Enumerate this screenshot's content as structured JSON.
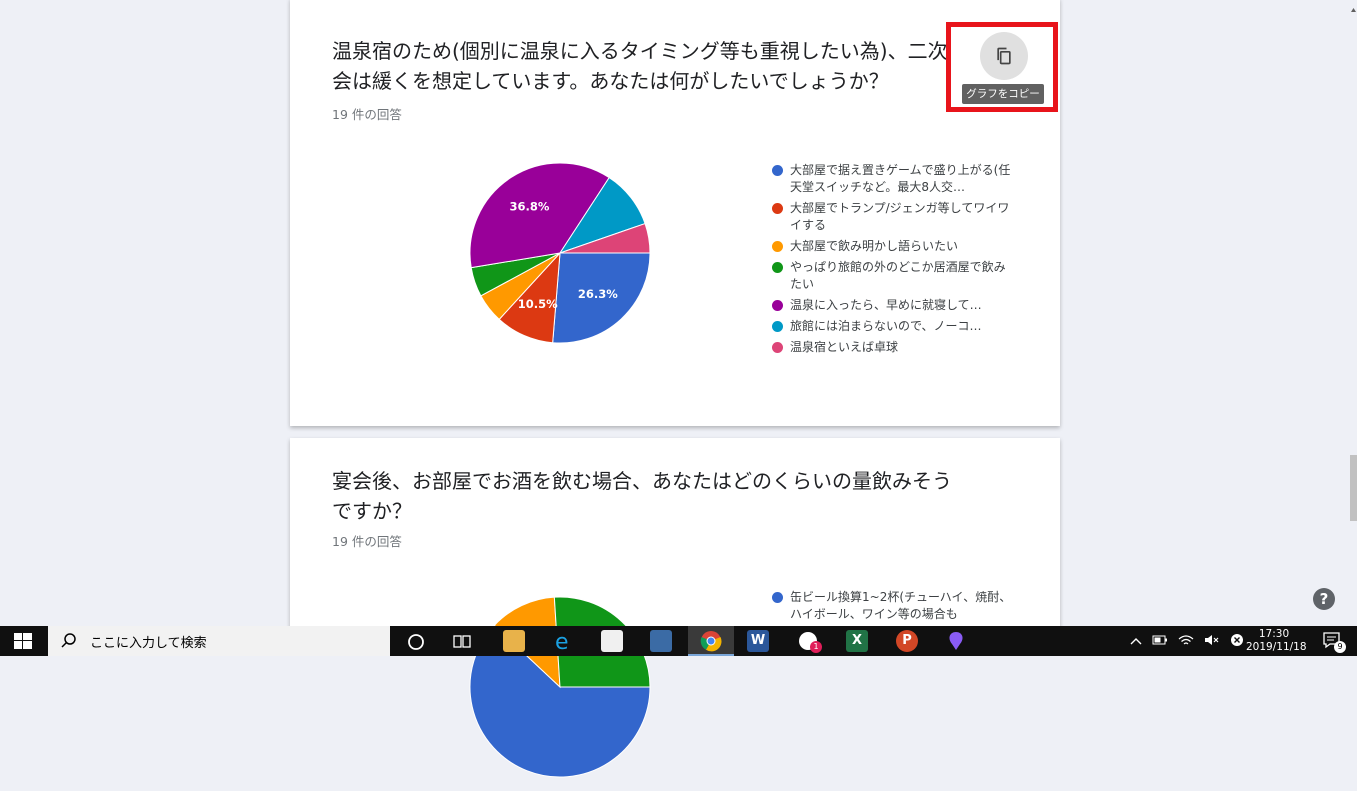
{
  "card1": {
    "question": "温泉宿のため(個別に温泉に入るタイミング等も重視したい為)、二次会は緩くを想定しています。あなたは何がしたいでしょうか？",
    "responses": "19 件の回答",
    "copy_tooltip": "グラフをコピー",
    "chart_data": {
      "type": "pie",
      "series": [
        {
          "name": "大部屋で据え置きゲームで盛り上がる(任天堂スイッチなど。最大8人交…",
          "value": 26.3,
          "color": "#3366cc",
          "label": "26.3%"
        },
        {
          "name": "大部屋でトランプ/ジェンガ等してワイワイする",
          "value": 10.5,
          "color": "#dc3912",
          "label": "10.5%"
        },
        {
          "name": "大部屋で飲み明かし語らいたい",
          "value": 5.3,
          "color": "#ff9900",
          "label": ""
        },
        {
          "name": "やっぱり旅館の外のどこか居酒屋で飲みたい",
          "value": 5.3,
          "color": "#109618",
          "label": ""
        },
        {
          "name": "温泉に入ったら、早めに就寝して…",
          "value": 36.8,
          "color": "#990099",
          "label": "36.8%"
        },
        {
          "name": "旅館には泊まらないので、ノーコ…",
          "value": 10.5,
          "color": "#0099c6",
          "label": ""
        },
        {
          "name": "温泉宿といえば卓球",
          "value": 5.3,
          "color": "#dd4477",
          "label": ""
        }
      ]
    }
  },
  "card2": {
    "question": "宴会後、お部屋でお酒を飲む場合、あなたはどのくらいの量飲みそうですか？",
    "responses": "19 件の回答",
    "legend": [
      {
        "name": "缶ビール換算1~2杯(チューハイ、焼酎、ハイボール、ワイン等の場合も",
        "color": "#3366cc"
      }
    ],
    "chart_data": {
      "type": "pie",
      "series": [
        {
          "name": "",
          "value": 62,
          "color": "#3366cc"
        },
        {
          "name": "",
          "value": 12,
          "color": "#ff9900"
        },
        {
          "name": "",
          "value": 26,
          "color": "#109618"
        }
      ]
    }
  },
  "help_label": "?",
  "taskbar": {
    "search_placeholder": "ここに入力して検索",
    "time": "17:30",
    "date": "2019/11/18",
    "notification_count": "9",
    "slack_badge": "1",
    "word_letter": "W",
    "excel_letter": "X",
    "ppt_letter": "P"
  },
  "colors": {
    "highlight": "#e8141b",
    "background": "#eef0f6"
  }
}
